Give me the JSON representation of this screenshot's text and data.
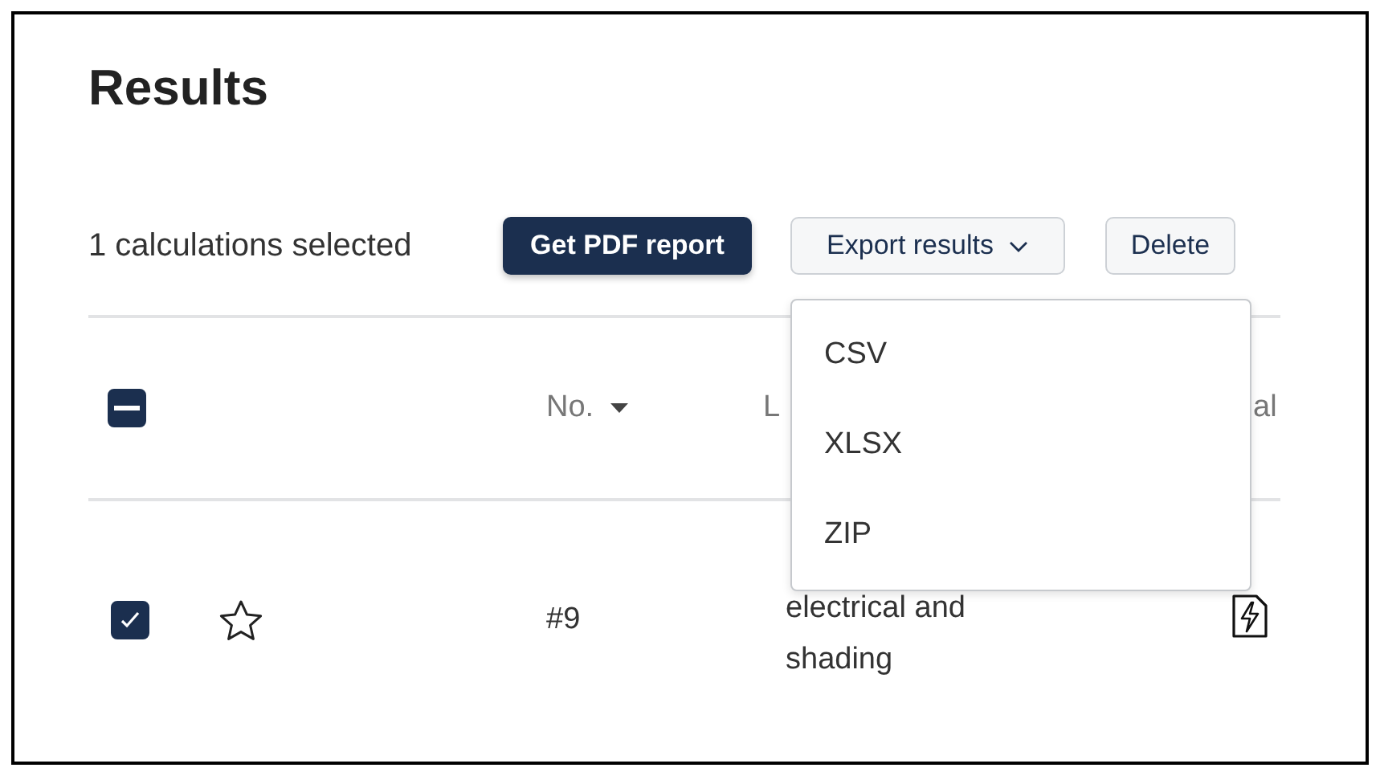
{
  "page": {
    "title": "Results"
  },
  "toolbar": {
    "selection_text": "1 calculations selected",
    "buttons": [
      {
        "label": "Get PDF report",
        "kind": "primary"
      },
      {
        "label": "Export results",
        "kind": "dropdown",
        "expanded": true
      },
      {
        "label": "Delete",
        "kind": "secondary"
      }
    ]
  },
  "export_menu": {
    "items": [
      "CSV",
      "XLSX",
      "ZIP"
    ]
  },
  "table": {
    "select_all": {
      "indeterminate": true
    },
    "columns": [
      {
        "label": "No.",
        "sorted": true
      },
      {
        "label": "L"
      },
      {
        "label": "al"
      }
    ],
    "rows": [
      {
        "checked": true,
        "starred": false,
        "number": "#9",
        "column_3": "electrical and shading"
      }
    ]
  }
}
